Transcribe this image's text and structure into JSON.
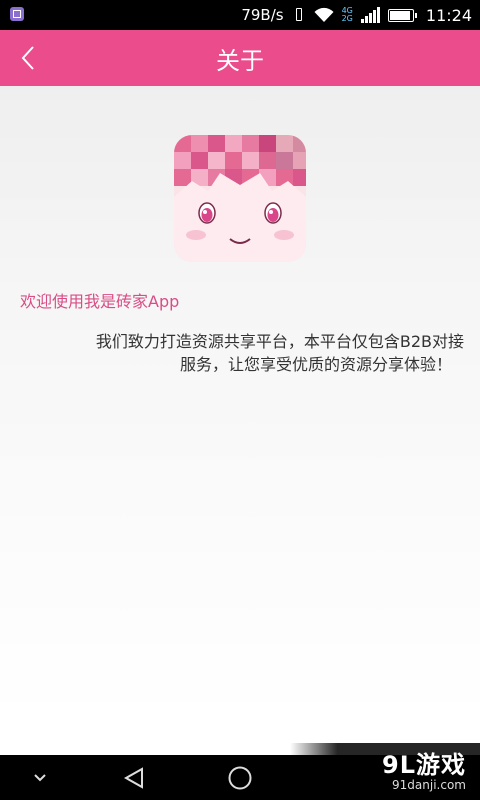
{
  "status_bar": {
    "net_speed": "79B/s",
    "network_top": "4G",
    "network_bottom": "2G",
    "time": "11:24",
    "battery_level": 0.9,
    "icons": [
      "gallery-icon",
      "vibrate-icon",
      "wifi-icon",
      "signal-icon",
      "battery-icon"
    ]
  },
  "header": {
    "back_icon": "chevron-left-icon",
    "title": "关于"
  },
  "about": {
    "welcome": "欢迎使用我是砖家App",
    "description_line1": "我们致力打造资源共享平台，本平台仅包含B2B对接",
    "description_line2": "服务，让您享受优质的资源分享体验！"
  },
  "nav_bar": {
    "icons": [
      "chevron-down-icon",
      "back-triangle-icon",
      "home-circle-icon"
    ]
  },
  "watermark": {
    "main": "9L游戏",
    "sub": "91danji.com"
  },
  "colors": {
    "accent": "#ea4c8c",
    "welcome_text": "#d94d86",
    "body_text": "#333333"
  }
}
